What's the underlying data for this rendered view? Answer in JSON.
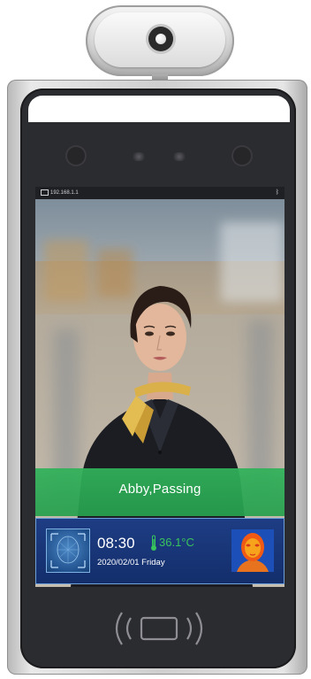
{
  "device": {
    "status_bar": {
      "ip_text": "192.168.1.1",
      "bluetooth_icon": "bluetooth-icon",
      "monitor_icon": "monitor-icon"
    },
    "pass_banner": {
      "message": "Abby,Passing"
    },
    "info_panel": {
      "time": "08:30",
      "temperature": "36.1°C",
      "date": "2020/02/01 Friday",
      "thermometer_icon": "thermometer-icon"
    },
    "nfc_icon": "nfc-card-icon"
  },
  "colors": {
    "pass_green": "#30b25a",
    "temperature_green": "#38c45c",
    "panel_blue": "#1e3d84",
    "bezel": "#2b2c30"
  }
}
